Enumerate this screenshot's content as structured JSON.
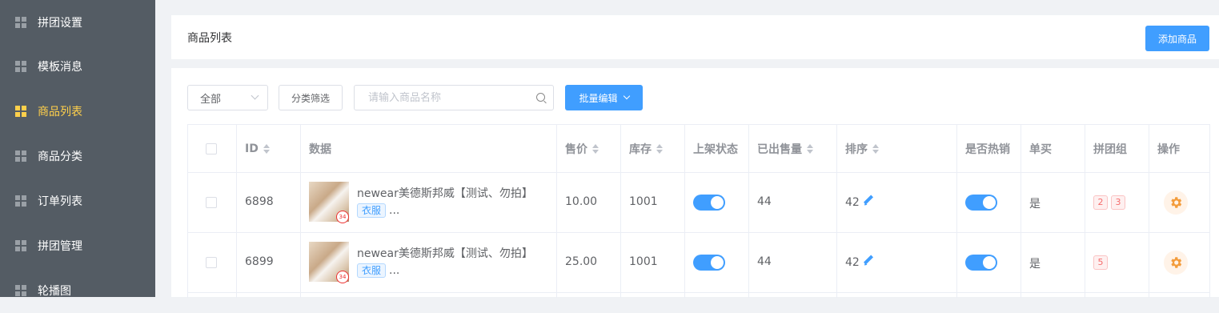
{
  "sidebar": {
    "items": [
      {
        "label": "拼团设置",
        "active": false
      },
      {
        "label": "模板消息",
        "active": false
      },
      {
        "label": "商品列表",
        "active": true
      },
      {
        "label": "商品分类",
        "active": false
      },
      {
        "label": "订单列表",
        "active": false
      },
      {
        "label": "拼团管理",
        "active": false
      },
      {
        "label": "轮播图",
        "active": false
      }
    ]
  },
  "header": {
    "title": "商品列表",
    "add_button": "添加商品"
  },
  "toolbar": {
    "status_select": "全部",
    "category_filter": "分类筛选",
    "search_placeholder": "请输入商品名称",
    "batch_edit": "批量编辑"
  },
  "table": {
    "columns": {
      "id": "ID",
      "data": "数据",
      "price": "售价",
      "stock": "库存",
      "status": "上架状态",
      "sold": "已出售量",
      "sort": "排序",
      "hot": "是否热销",
      "single": "单买",
      "groups": "拼团组",
      "action": "操作"
    },
    "rows": [
      {
        "id": "6898",
        "name": "newear美德斯邦威【测试、勿拍】",
        "category": "衣服",
        "more": "...",
        "price": "10.00",
        "stock": "1001",
        "on_shelf": true,
        "sold": "44",
        "sort": "42",
        "hot": true,
        "single": "是",
        "groups": [
          "2",
          "3"
        ]
      },
      {
        "id": "6899",
        "name": "newear美德斯邦威【测试、勿拍】",
        "category": "衣服",
        "more": "...",
        "price": "25.00",
        "stock": "1001",
        "on_shelf": true,
        "sold": "44",
        "sort": "42",
        "hot": true,
        "single": "是",
        "groups": [
          "5"
        ]
      }
    ]
  },
  "colors": {
    "sidebar_bg": "#545c64",
    "active": "#ffd04b",
    "primary": "#409eff",
    "gear": "#f39c3c"
  },
  "icons": [
    "grid-icon",
    "chevron-down-icon",
    "search-icon",
    "sort-icon",
    "pencil-icon",
    "gear-icon"
  ]
}
